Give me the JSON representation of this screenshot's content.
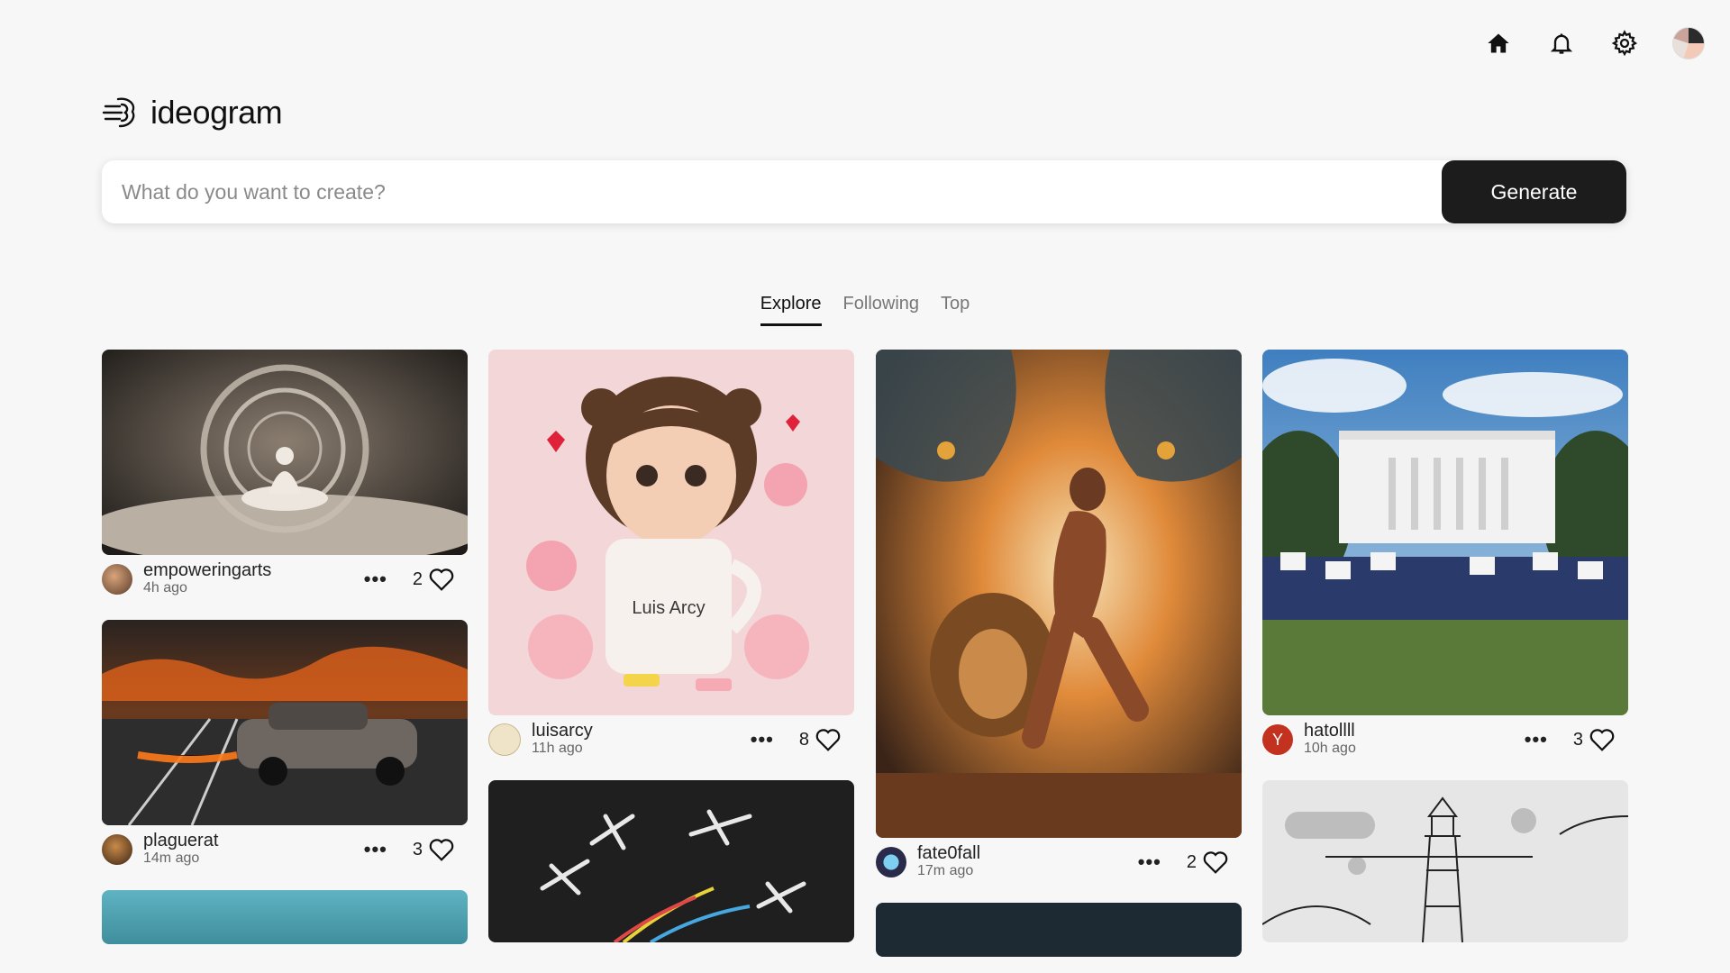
{
  "nav": {
    "home_icon": "home-icon",
    "notifications_icon": "bell-icon",
    "settings_icon": "gear-icon"
  },
  "brand": {
    "name": "ideogram"
  },
  "search": {
    "placeholder": "What do you want to create?",
    "value": "",
    "button_label": "Generate"
  },
  "tabs": [
    {
      "label": "Explore",
      "active": true
    },
    {
      "label": "Following",
      "active": false
    },
    {
      "label": "Top",
      "active": false
    }
  ],
  "posts": [
    {
      "user": "empoweringarts",
      "time": "4h ago",
      "likes": "2"
    },
    {
      "user": "plaguerat",
      "time": "14m ago",
      "likes": "3"
    },
    {
      "user": "luisarcy",
      "time": "11h ago",
      "likes": "8",
      "image_text": "Luis Arcy"
    },
    {
      "user": "fate0fall",
      "time": "17m ago",
      "likes": "2"
    },
    {
      "user": "hatollll",
      "time": "10h ago",
      "likes": "3",
      "avatar_letter": "Y"
    }
  ],
  "colors": {
    "accent": "#1c1c1c",
    "avatar_red": "#c2321f",
    "background": "#f7f7f7"
  }
}
